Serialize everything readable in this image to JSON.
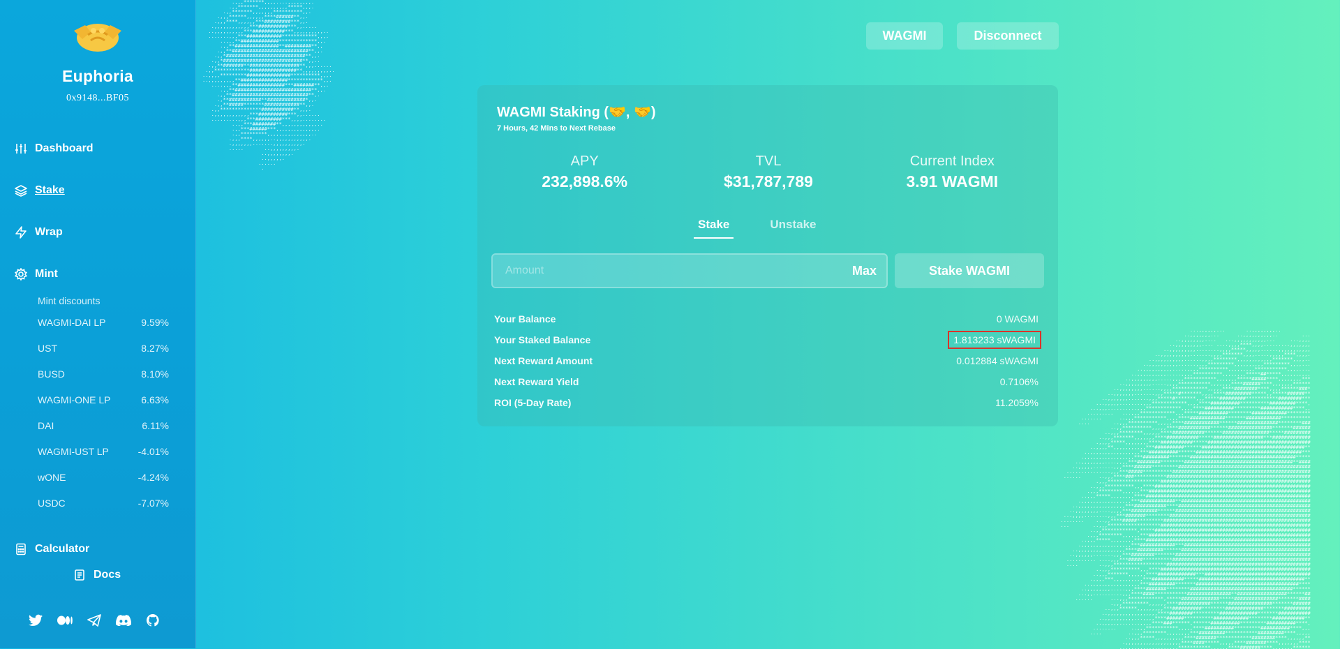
{
  "sidebar": {
    "brand": "Euphoria",
    "wallet": "0x9148...BF05",
    "nav": {
      "dashboard": "Dashboard",
      "stake": "Stake",
      "wrap": "Wrap",
      "mint": "Mint",
      "calculator": "Calculator",
      "docs": "Docs"
    },
    "mint_title": "Mint discounts",
    "mint_items": [
      {
        "name": "WAGMI-DAI LP",
        "rate": "9.59%"
      },
      {
        "name": "UST",
        "rate": "8.27%"
      },
      {
        "name": "BUSD",
        "rate": "8.10%"
      },
      {
        "name": "WAGMI-ONE LP",
        "rate": "6.63%"
      },
      {
        "name": "DAI",
        "rate": "6.11%"
      },
      {
        "name": "WAGMI-UST LP",
        "rate": "-4.01%"
      },
      {
        "name": "wONE",
        "rate": "-4.24%"
      },
      {
        "name": "USDC",
        "rate": "-7.07%"
      }
    ],
    "socials": [
      "twitter-icon",
      "medium-icon",
      "telegram-icon",
      "discord-icon",
      "github-icon"
    ]
  },
  "header": {
    "token_button": "WAGMI",
    "disconnect_button": "Disconnect"
  },
  "card": {
    "title": "WAGMI Staking (🤝, 🤝)",
    "subtitle": "7 Hours, 42 Mins to Next Rebase",
    "stats": {
      "apy_label": "APY",
      "apy_value": "232,898.6%",
      "tvl_label": "TVL",
      "tvl_value": "$31,787,789",
      "index_label": "Current Index",
      "index_value": "3.91 WAGMI"
    },
    "tabs": {
      "stake": "Stake",
      "unstake": "Unstake"
    },
    "amount_placeholder": "Amount",
    "max_label": "Max",
    "stake_button": "Stake WAGMI",
    "info": {
      "balance_label": "Your Balance",
      "balance_value": "0 WAGMI",
      "staked_label": "Your Staked Balance",
      "staked_value": "1.813233 sWAGMI",
      "reward_amount_label": "Next Reward Amount",
      "reward_amount_value": "0.012884 sWAGMI",
      "reward_yield_label": "Next Reward Yield",
      "reward_yield_value": "0.7106%",
      "roi_label": "ROI (5-Day Rate)",
      "roi_value": "11.2059%"
    }
  },
  "colors": {
    "highlight_border": "#d9342a",
    "sidebar_bg": "#0ba7dc",
    "gradient_start": "#13b5e4",
    "gradient_end": "#64f0bd"
  }
}
